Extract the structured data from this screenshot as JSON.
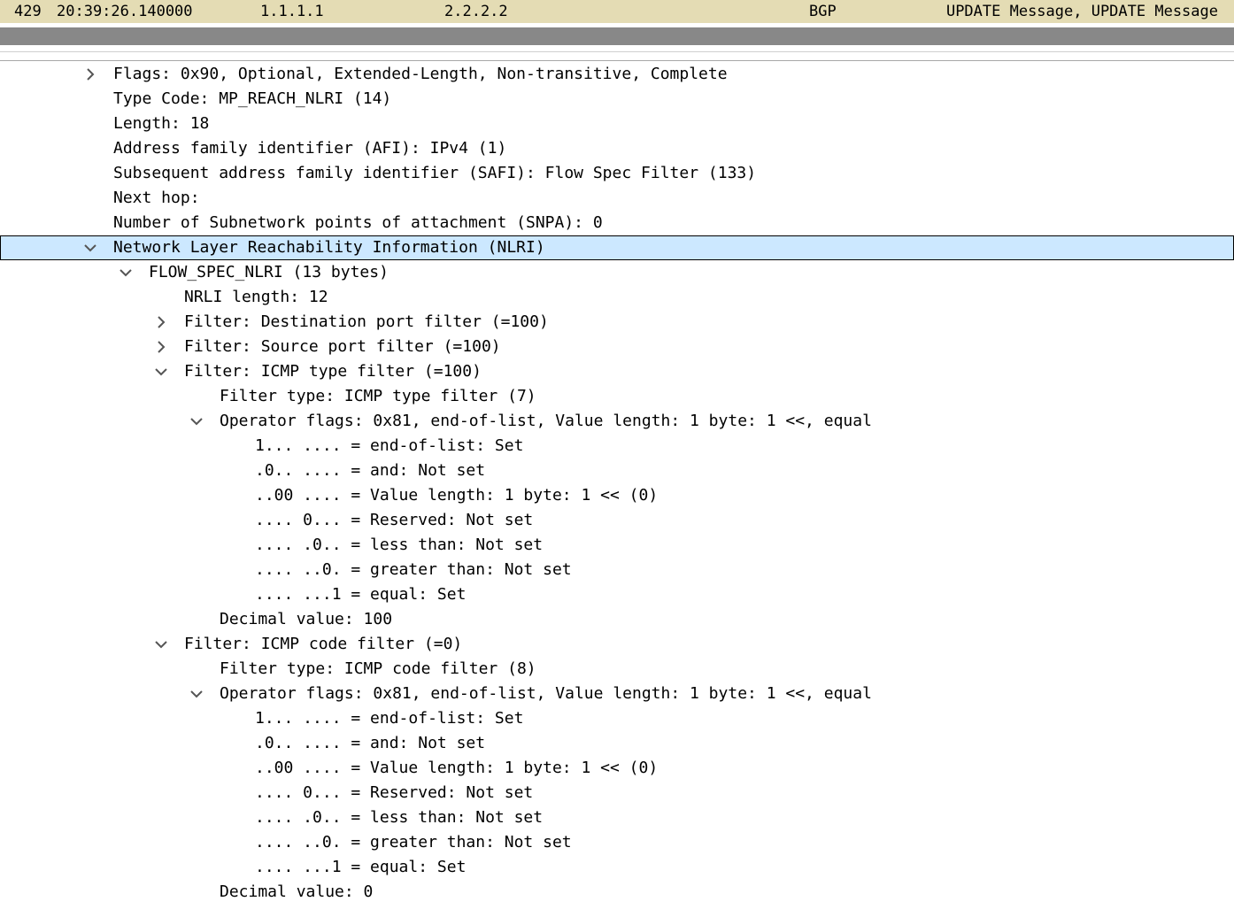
{
  "packet_list": {
    "selected_row": {
      "no": "429",
      "time": "20:39:26.140000",
      "source": "1.1.1.1",
      "destination": "2.2.2.2",
      "protocol": "BGP",
      "info": "UPDATE Message, UPDATE Message"
    }
  },
  "details": {
    "rows": [
      {
        "text": "Flags: 0x90, Optional, Extended-Length, Non-transitive, Complete",
        "indent": 0,
        "toggle": "collapsed",
        "selected": false
      },
      {
        "text": "Type Code: MP_REACH_NLRI (14)",
        "indent": 0,
        "toggle": "none",
        "selected": false
      },
      {
        "text": "Length: 18",
        "indent": 0,
        "toggle": "none",
        "selected": false
      },
      {
        "text": "Address family identifier (AFI): IPv4 (1)",
        "indent": 0,
        "toggle": "none",
        "selected": false
      },
      {
        "text": "Subsequent address family identifier (SAFI): Flow Spec Filter (133)",
        "indent": 0,
        "toggle": "none",
        "selected": false
      },
      {
        "text": "Next hop:",
        "indent": 0,
        "toggle": "none",
        "selected": false
      },
      {
        "text": "Number of Subnetwork points of attachment (SNPA): 0",
        "indent": 0,
        "toggle": "none",
        "selected": false
      },
      {
        "text": "Network Layer Reachability Information (NLRI)",
        "indent": 0,
        "toggle": "expanded",
        "selected": true
      },
      {
        "text": "FLOW_SPEC_NLRI (13 bytes)",
        "indent": 1,
        "toggle": "expanded",
        "selected": false
      },
      {
        "text": "NRLI length: 12",
        "indent": 2,
        "toggle": "none",
        "selected": false
      },
      {
        "text": "Filter: Destination port filter (=100)",
        "indent": 2,
        "toggle": "collapsed",
        "selected": false
      },
      {
        "text": "Filter: Source port filter (=100)",
        "indent": 2,
        "toggle": "collapsed",
        "selected": false
      },
      {
        "text": "Filter: ICMP type filter (=100)",
        "indent": 2,
        "toggle": "expanded",
        "selected": false
      },
      {
        "text": "Filter type: ICMP type filter (7)",
        "indent": 3,
        "toggle": "none",
        "selected": false
      },
      {
        "text": "Operator flags: 0x81, end-of-list, Value length: 1 byte: 1 <<, equal",
        "indent": 3,
        "toggle": "expanded",
        "selected": false
      },
      {
        "text": "1... .... = end-of-list: Set",
        "indent": 4,
        "toggle": "none",
        "selected": false
      },
      {
        "text": ".0.. .... = and: Not set",
        "indent": 4,
        "toggle": "none",
        "selected": false
      },
      {
        "text": "..00 .... = Value length: 1 byte: 1 << (0)",
        "indent": 4,
        "toggle": "none",
        "selected": false
      },
      {
        "text": ".... 0... = Reserved: Not set",
        "indent": 4,
        "toggle": "none",
        "selected": false
      },
      {
        "text": ".... .0.. = less than: Not set",
        "indent": 4,
        "toggle": "none",
        "selected": false
      },
      {
        "text": ".... ..0. = greater than: Not set",
        "indent": 4,
        "toggle": "none",
        "selected": false
      },
      {
        "text": ".... ...1 = equal: Set",
        "indent": 4,
        "toggle": "none",
        "selected": false
      },
      {
        "text": "Decimal value: 100",
        "indent": 3,
        "toggle": "none",
        "selected": false
      },
      {
        "text": "Filter: ICMP code filter (=0)",
        "indent": 2,
        "toggle": "expanded",
        "selected": false
      },
      {
        "text": "Filter type: ICMP code filter (8)",
        "indent": 3,
        "toggle": "none",
        "selected": false
      },
      {
        "text": "Operator flags: 0x81, end-of-list, Value length: 1 byte: 1 <<, equal",
        "indent": 3,
        "toggle": "expanded",
        "selected": false
      },
      {
        "text": "1... .... = end-of-list: Set",
        "indent": 4,
        "toggle": "none",
        "selected": false
      },
      {
        "text": ".0.. .... = and: Not set",
        "indent": 4,
        "toggle": "none",
        "selected": false
      },
      {
        "text": "..00 .... = Value length: 1 byte: 1 << (0)",
        "indent": 4,
        "toggle": "none",
        "selected": false
      },
      {
        "text": ".... 0... = Reserved: Not set",
        "indent": 4,
        "toggle": "none",
        "selected": false
      },
      {
        "text": ".... .0.. = less than: Not set",
        "indent": 4,
        "toggle": "none",
        "selected": false
      },
      {
        "text": ".... ..0. = greater than: Not set",
        "indent": 4,
        "toggle": "none",
        "selected": false
      },
      {
        "text": ".... ...1 = equal: Set",
        "indent": 4,
        "toggle": "none",
        "selected": false
      },
      {
        "text": "Decimal value: 0",
        "indent": 3,
        "toggle": "none",
        "selected": false
      }
    ]
  },
  "colors": {
    "packet_row_bg": "#e4dcb4",
    "splitter": "#888888",
    "selection_bg": "#cce8ff",
    "chevron": "#555555"
  },
  "icons": {
    "collapsed": "chevron-right-icon",
    "expanded": "chevron-down-icon"
  }
}
